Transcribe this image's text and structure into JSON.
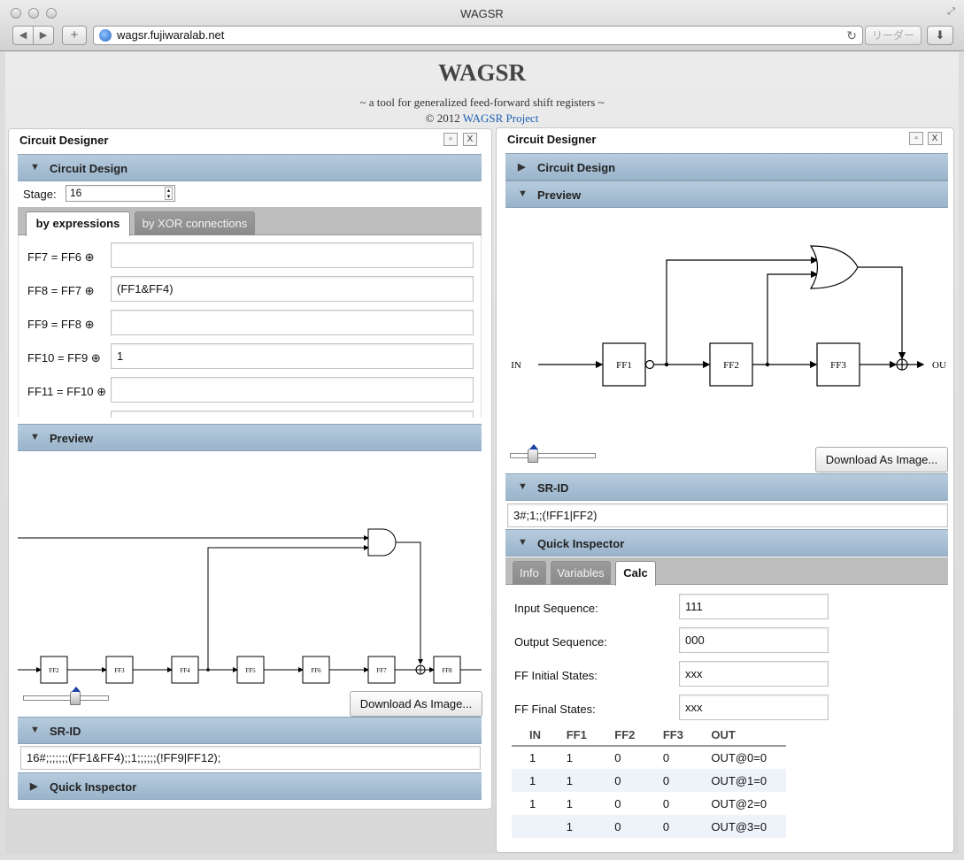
{
  "window": {
    "title": "WAGSR"
  },
  "toolbar": {
    "back": "◀",
    "forward": "▶",
    "add": "+",
    "url": "wagsr.fujiwaralab.net",
    "reload": "↻",
    "reader": "リーダー",
    "downloads": "⬇"
  },
  "page": {
    "brand": "WAGSR",
    "tagline": "~ a tool for generalized feed-forward shift registers ~",
    "copyright_prefix": "© 2012",
    "copyright_link": "WAGSR Project"
  },
  "left_panel": {
    "title": "Circuit Designer",
    "minimize": "▫",
    "close": "X",
    "circuit_design_label": "Circuit Design",
    "stage_label": "Stage:",
    "stage_value": "16",
    "tabs": [
      "by expressions",
      "by XOR connections"
    ],
    "expressions": [
      {
        "label": "FF7 = FF6 ⊕",
        "value": ""
      },
      {
        "label": "FF8 = FF7 ⊕",
        "value": "(FF1&FF4)"
      },
      {
        "label": "FF9 = FF8 ⊕",
        "value": ""
      },
      {
        "label": "FF10 = FF9 ⊕",
        "value": "1"
      },
      {
        "label": "FF11 = FF10 ⊕",
        "value": ""
      }
    ],
    "preview_label": "Preview",
    "diagram_ffs": [
      "FF2",
      "FF3",
      "FF4",
      "FF5",
      "FF6",
      "FF7",
      "FF8"
    ],
    "slider_level": 0.62,
    "download_label": "Download As Image...",
    "srid_label": "SR-ID",
    "srid_value": "16#;;;;;;;(FF1&FF4);;1;;;;;;(!FF9|FF12);",
    "quick_inspector_label": "Quick Inspector"
  },
  "right_panel": {
    "title": "Circuit Designer",
    "minimize": "▫",
    "close": "X",
    "circuit_design_label": "Circuit Design",
    "preview_label": "Preview",
    "diagram": {
      "in": "IN",
      "out": "OU",
      "ffs": [
        "FF1",
        "FF2",
        "FF3"
      ]
    },
    "slider_level": 0.23,
    "download_label": "Download As Image...",
    "srid_label": "SR-ID",
    "srid_value": "3#;1;;(!FF1|FF2)",
    "quick_inspector_label": "Quick Inspector",
    "qi_tabs": [
      "Info",
      "Variables",
      "Calc"
    ],
    "calc_fields": [
      {
        "label": "Input Sequence:",
        "value": "111"
      },
      {
        "label": "Output Sequence:",
        "value": "000"
      },
      {
        "label": "FF Initial States:",
        "value": "xxx"
      },
      {
        "label": "FF Final States:",
        "value": "xxx"
      }
    ],
    "table": {
      "headers": [
        "IN",
        "FF1",
        "FF2",
        "FF3",
        "OUT"
      ],
      "rows": [
        [
          "1",
          "1",
          "0",
          "0",
          "OUT@0=0"
        ],
        [
          "1",
          "1",
          "0",
          "0",
          "OUT@1=0"
        ],
        [
          "1",
          "1",
          "0",
          "0",
          "OUT@2=0"
        ],
        [
          "",
          "1",
          "0",
          "0",
          "OUT@3=0"
        ]
      ]
    }
  },
  "colors": {
    "accordion": "#a9c0d5",
    "link": "#1a5fb4",
    "slider_arrow": "#1c3fa8"
  }
}
